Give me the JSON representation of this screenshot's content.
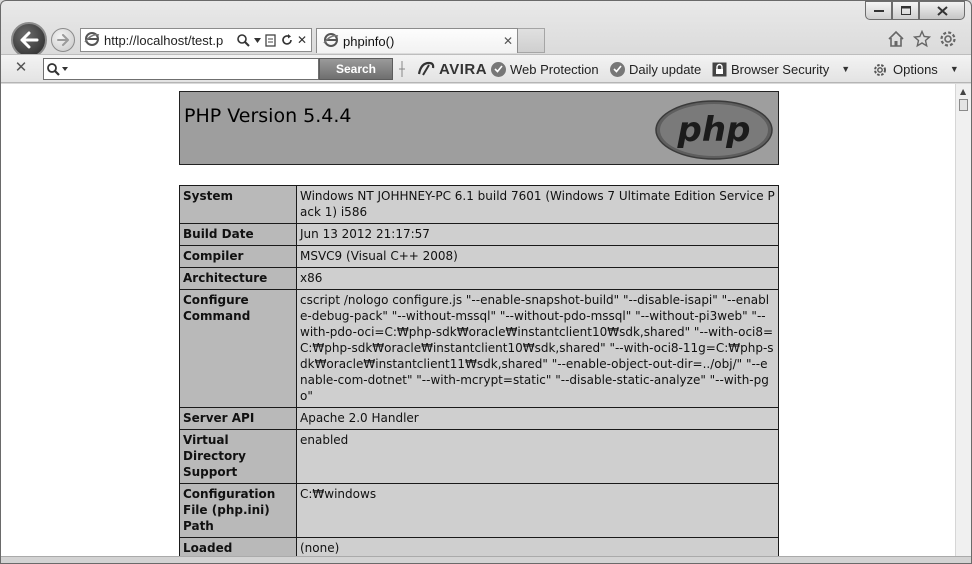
{
  "browser": {
    "address_url": "http://localhost/test.p",
    "tab_title": "phpinfo()",
    "tab_close": "✕",
    "addr_close": "✕"
  },
  "toolbar": {
    "close": "✕",
    "search_placeholder": "",
    "search_button": "Search",
    "brand": "AVIRA",
    "web_protection": "Web Protection",
    "daily_update": "Daily update",
    "browser_security": "Browser Security",
    "options": "Options"
  },
  "page": {
    "title": "PHP Version 5.4.4",
    "logo_text": "php",
    "rows": [
      {
        "key": "System",
        "value": "Windows NT JOHHNEY-PC 6.1 build 7601 (Windows 7 Ultimate Edition Service Pack 1) i586"
      },
      {
        "key": "Build Date",
        "value": "Jun 13 2012 21:17:57"
      },
      {
        "key": "Compiler",
        "value": "MSVC9 (Visual C++ 2008)"
      },
      {
        "key": "Architecture",
        "value": "x86"
      },
      {
        "key": "Configure Command",
        "value": "cscript /nologo configure.js \"--enable-snapshot-build\" \"--disable-isapi\" \"--enable-debug-pack\" \"--without-mssql\" \"--without-pdo-mssql\" \"--without-pi3web\" \"--with-pdo-oci=C:₩php-sdk₩oracle₩instantclient10₩sdk,shared\" \"--with-oci8=C:₩php-sdk₩oracle₩instantclient10₩sdk,shared\" \"--with-oci8-11g=C:₩php-sdk₩oracle₩instantclient11₩sdk,shared\" \"--enable-object-out-dir=../obj/\" \"--enable-com-dotnet\" \"--with-mcrypt=static\" \"--disable-static-analyze\" \"--with-pgo\""
      },
      {
        "key": "Server API",
        "value": "Apache 2.0 Handler"
      },
      {
        "key": "Virtual Directory Support",
        "value": "enabled"
      },
      {
        "key": "Configuration File (php.ini) Path",
        "value": "C:₩windows"
      },
      {
        "key": "Loaded Configuration File",
        "value": "(none)"
      }
    ]
  }
}
